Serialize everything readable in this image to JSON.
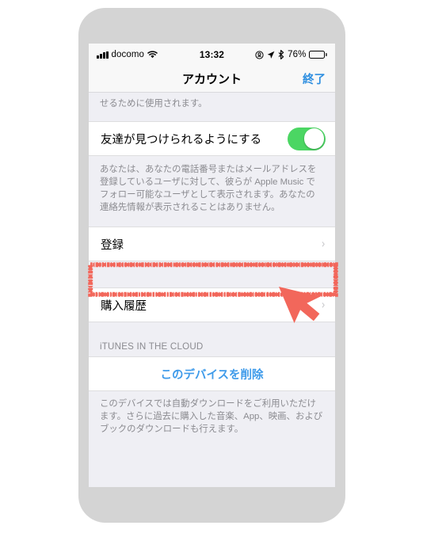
{
  "device": {
    "frame_color": "#d4d4d4",
    "screen_background": "#efeff4"
  },
  "status_bar": {
    "carrier": "docomo",
    "signal_icon": "signal-bars-icon",
    "wifi_icon": "wifi-icon",
    "time": "13:32",
    "alarm_icon": "do-not-disturb-icon",
    "location_icon": "location-arrow-icon",
    "bluetooth_icon": "bluetooth-icon",
    "battery_percent": "76%",
    "battery_level": 76,
    "battery_icon": "battery-icon"
  },
  "nav_bar": {
    "title": "アカウント",
    "done_label": "終了",
    "done_color": "#2f8fe0"
  },
  "content": {
    "top_note": "せるために使用されます。",
    "find_friends": {
      "label": "友達が見つけられるようにする",
      "toggle_on": true,
      "toggle_color": "#4bd663"
    },
    "find_friends_note": "あなたは、あなたの電話番号またはメールアドレスを登録しているユーザに対して、彼らが Apple Music でフォロー可能なユーザとして表示されます。あなたの連絡先情報が表示されることはありません。",
    "rows": [
      {
        "label": "登録",
        "chevron": "chevron-right-icon",
        "highlighted": true
      },
      {
        "label": "購入履歴",
        "chevron": "chevron-right-icon",
        "highlighted": false
      }
    ],
    "cloud_section": {
      "header": "iTUNES IN THE CLOUD",
      "delete_label": "このデバイスを削除",
      "delete_color": "#3f9bea",
      "note": "このデバイスでは自動ダウンロードをご利用いただけます。さらに過去に購入した音楽、App、映画、およびブックのダウンロードも行えます。"
    }
  },
  "annotation": {
    "highlight_color": "#f2675b",
    "cursor_color": "#f2675b",
    "cursor_icon": "mouse-pointer-icon",
    "highlight_target": "登録"
  }
}
